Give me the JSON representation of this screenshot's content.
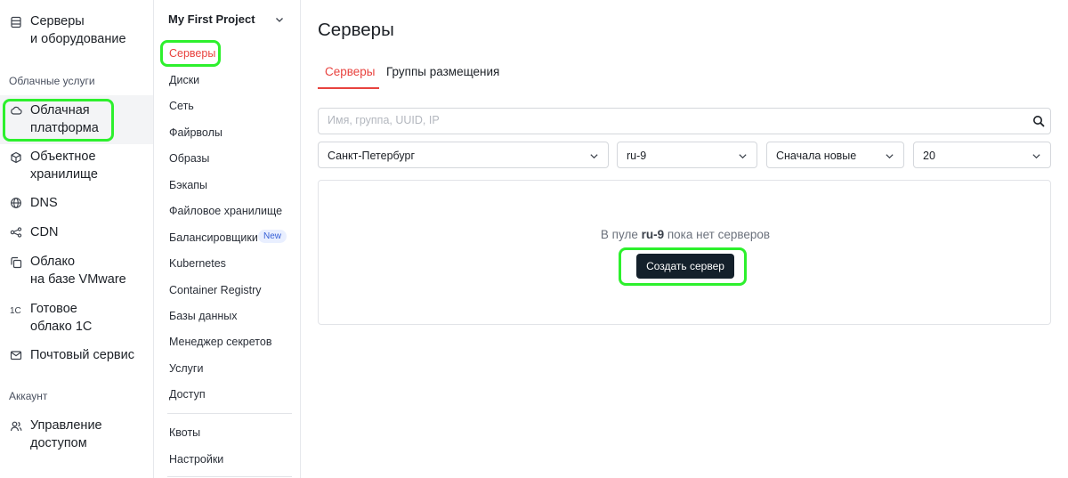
{
  "sidebar": {
    "items": [
      {
        "label": "Серверы\nи оборудование",
        "icon": "server-icon"
      },
      {
        "label": "Облачная\nплатформа",
        "icon": "cloud-icon",
        "active": true
      },
      {
        "label": "Объектное\nхранилище",
        "icon": "cube-icon"
      },
      {
        "label": "DNS",
        "icon": "globe-icon"
      },
      {
        "label": "CDN",
        "icon": "nodes-icon"
      },
      {
        "label": "Облако\nна базе VMware",
        "icon": "copy-icon"
      },
      {
        "label": "Готовое\nоблако 1С",
        "icon": "1c-icon"
      },
      {
        "label": "Почтовый сервис",
        "icon": "mail-icon"
      },
      {
        "label": "Управление\nдоступом",
        "icon": "users-icon"
      }
    ],
    "section_cloud": "Облачные услуги",
    "section_account": "Аккаунт"
  },
  "project": {
    "name": "My First Project",
    "items": [
      "Серверы",
      "Диски",
      "Сеть",
      "Файрволы",
      "Образы",
      "Бэкапы",
      "Файловое хранилище",
      "Балансировщики",
      "Kubernetes",
      "Container Registry",
      "Базы данных",
      "Менеджер секретов",
      "Услуги",
      "Доступ",
      "Квоты",
      "Настройки"
    ],
    "badge_new": "New"
  },
  "main": {
    "title": "Серверы",
    "tabs": [
      "Серверы",
      "Группы размещения"
    ],
    "search_placeholder": "Имя, группа, UUID, IP",
    "filters": {
      "region": "Санкт-Петербург",
      "pool": "ru-9",
      "sort": "Сначала новые",
      "per_page": "20"
    },
    "empty": {
      "prefix": "В пуле ",
      "pool": "ru-9",
      "suffix": " пока нет серверов",
      "button": "Создать сервер"
    }
  },
  "colors": {
    "accent": "#e8433f",
    "button": "#14202b",
    "highlight": "#2df02d"
  }
}
